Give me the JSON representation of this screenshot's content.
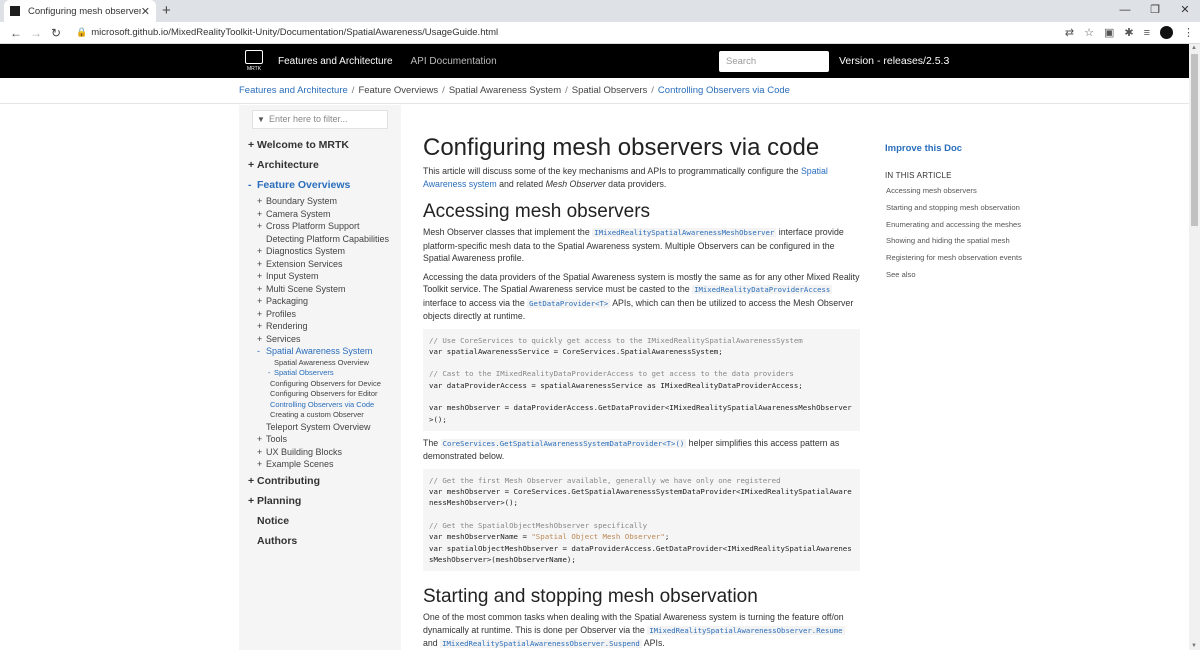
{
  "browser": {
    "tab_title": "Configuring mesh observers via",
    "tab_close": "✕",
    "new_tab": "+",
    "url": "microsoft.github.io/MixedRealityToolkit-Unity/Documentation/SpatialAwareness/UsageGuide.html",
    "controls": {
      "minimize": "—",
      "maximize": "❐",
      "close": "✕"
    }
  },
  "header": {
    "logo_text": "MRTK",
    "nav": [
      "Features and Architecture",
      "API Documentation"
    ],
    "search_placeholder": "Search",
    "version": "Version - releases/2.5.3"
  },
  "breadcrumb": [
    "Features and Architecture",
    "Feature Overviews",
    "Spatial Awareness System",
    "Spatial Observers",
    "Controlling Observers via Code"
  ],
  "sidebar": {
    "filter_placeholder": "Enter here to filter...",
    "toc": [
      {
        "level": 1,
        "marker": "+",
        "label": "Welcome to MRTK"
      },
      {
        "level": 1,
        "marker": "+",
        "label": "Architecture"
      },
      {
        "level": 1,
        "marker": "-",
        "label": "Feature Overviews",
        "open": true
      },
      {
        "level": 2,
        "marker": "+",
        "label": "Boundary System"
      },
      {
        "level": 2,
        "marker": "+",
        "label": "Camera System"
      },
      {
        "level": 2,
        "marker": "+",
        "label": "Cross Platform Support"
      },
      {
        "level": 2,
        "marker": "",
        "label": "Detecting Platform Capabilities"
      },
      {
        "level": 2,
        "marker": "+",
        "label": "Diagnostics System"
      },
      {
        "level": 2,
        "marker": "+",
        "label": "Extension Services"
      },
      {
        "level": 2,
        "marker": "+",
        "label": "Input System"
      },
      {
        "level": 2,
        "marker": "+",
        "label": "Multi Scene System"
      },
      {
        "level": 2,
        "marker": "+",
        "label": "Packaging"
      },
      {
        "level": 2,
        "marker": "+",
        "label": "Profiles"
      },
      {
        "level": 2,
        "marker": "+",
        "label": "Rendering"
      },
      {
        "level": 2,
        "marker": "+",
        "label": "Services"
      },
      {
        "level": 2,
        "marker": "-",
        "label": "Spatial Awareness System",
        "open": true
      },
      {
        "level": 3,
        "marker": "",
        "label": "Spatial Awareness Overview"
      },
      {
        "level": 3,
        "marker": "-",
        "label": "Spatial Observers",
        "open": true
      },
      {
        "level": 4,
        "label": "Configuring Observers for Device"
      },
      {
        "level": 4,
        "label": "Configuring Observers for Editor"
      },
      {
        "level": 4,
        "label": "Controlling Observers via Code",
        "active": true
      },
      {
        "level": 4,
        "label": "Creating a custom Observer"
      },
      {
        "level": 2,
        "marker": "",
        "label": "Teleport System Overview"
      },
      {
        "level": 2,
        "marker": "+",
        "label": "Tools"
      },
      {
        "level": 2,
        "marker": "+",
        "label": "UX Building Blocks"
      },
      {
        "level": 2,
        "marker": "+",
        "label": "Example Scenes"
      },
      {
        "level": 1,
        "marker": "+",
        "label": "Contributing"
      },
      {
        "level": 1,
        "marker": "+",
        "label": "Planning"
      },
      {
        "level": 1,
        "marker": "",
        "label": "Notice"
      },
      {
        "level": 1,
        "marker": "",
        "label": "Authors"
      }
    ]
  },
  "article": {
    "title": "Configuring mesh observers via code",
    "intro_1": "This article will discuss some of the key mechanisms and APIs to programmatically configure the ",
    "intro_link": "Spatial Awareness system",
    "intro_2": " and related ",
    "intro_em": "Mesh Observer",
    "intro_3": " data providers.",
    "h_accessing": "Accessing mesh observers",
    "p1_a": "Mesh Observer classes that implement the ",
    "p1_code": "IMixedRealitySpatialAwarenessMeshObserver",
    "p1_b": " interface provide platform-specific mesh data to the Spatial Awareness system. Multiple Observers can be configured in the Spatial Awareness profile.",
    "p2_a": "Accessing the data providers of the Spatial Awareness system is mostly the same as for any other Mixed Reality Toolkit service. The Spatial Awareness service must be casted to the ",
    "p2_code": "IMixedRealityDataProviderAccess",
    "p2_b": " interface to access via the ",
    "p2_code2": "GetDataProvider<T>",
    "p2_c": " APIs, which can then be utilized to access the Mesh Observer objects directly at runtime.",
    "code1": {
      "c1": "// Use CoreServices to quickly get access to the IMixedRealitySpatialAwarenessSystem",
      "l1": "var spatialAwarenessService = CoreServices.SpatialAwarenessSystem;",
      "c2": "// Cast to the IMixedRealityDataProviderAccess to get access to the data providers",
      "l2": "var dataProviderAccess = spatialAwarenessService as IMixedRealityDataProviderAccess;",
      "l3": "var meshObserver = dataProviderAccess.GetDataProvider<IMixedRealitySpatialAwarenessMeshObserver>();"
    },
    "p3_a": "The ",
    "p3_code": "CoreServices.GetSpatialAwarenessSystemDataProvider<T>()",
    "p3_b": " helper simplifies this access pattern as demonstrated below.",
    "code2": {
      "c1": "// Get the first Mesh Observer available, generally we have only one registered",
      "l1": "var meshObserver = CoreServices.GetSpatialAwarenessSystemDataProvider<IMixedRealitySpatialAwarenessMeshObserver>();",
      "c2": "// Get the SpatialObjectMeshObserver specifically",
      "l2a": "var meshObserverName = ",
      "l2s": "\"Spatial Object Mesh Observer\"",
      "l2b": ";",
      "l3": "var spatialObjectMeshObserver = dataProviderAccess.GetDataProvider<IMixedRealitySpatialAwarenessMeshObserver>(meshObserverName);"
    },
    "h_starting": "Starting and stopping mesh observation",
    "p4_a": "One of the most common tasks when dealing with the Spatial Awareness system is turning the feature off/on dynamically at runtime. This is done per Observer via the ",
    "p4_code": "IMixedRealitySpatialAwarenessObserver.Resume",
    "p4_b": " and ",
    "p4_code2": "IMixedRealitySpatialAwarenessObserver.Suspend",
    "p4_c": " APIs."
  },
  "rightnav": {
    "improve": "Improve this Doc",
    "in_this_article": "IN THIS ARTICLE",
    "items": [
      "Accessing mesh observers",
      "Starting and stopping mesh observation",
      "Enumerating and accessing the meshes",
      "Showing and hiding the spatial mesh",
      "Registering for mesh observation events",
      "See also"
    ]
  }
}
